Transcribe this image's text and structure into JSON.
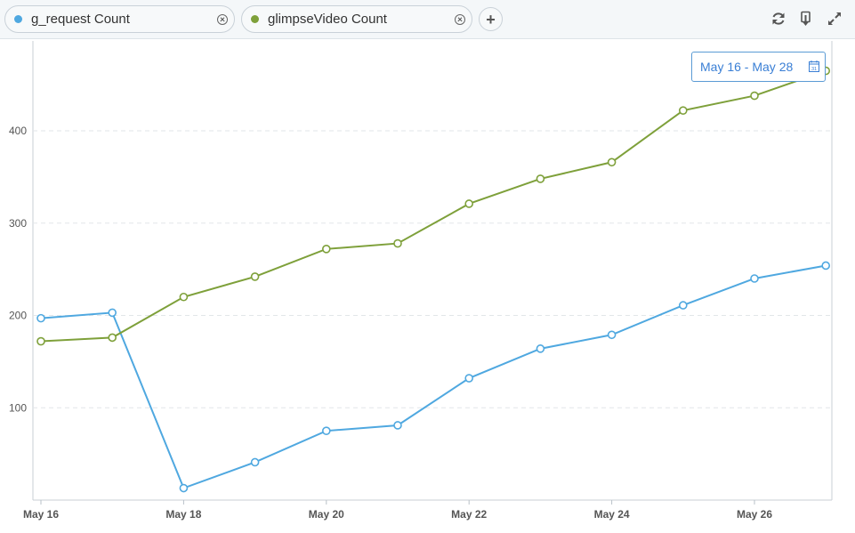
{
  "toolbar": {
    "pills": [
      {
        "label": "g_request Count",
        "color": "#4fa8e0"
      },
      {
        "label": "glimpseVideo Count",
        "color": "#7ea03a"
      }
    ],
    "add_label": "+",
    "icons": [
      "refresh-icon",
      "export-icon",
      "expand-icon"
    ]
  },
  "date_range": {
    "label": "May 16 - May 28",
    "icon": "calendar-icon"
  },
  "chart_data": {
    "type": "line",
    "x": [
      "May 16",
      "May 17",
      "May 18",
      "May 19",
      "May 20",
      "May 21",
      "May 22",
      "May 23",
      "May 24",
      "May 25",
      "May 26",
      "May 27"
    ],
    "x_tick_labels": [
      "May 16",
      "May 18",
      "May 20",
      "May 22",
      "May 24",
      "May 26"
    ],
    "series": [
      {
        "name": "g_request Count",
        "color": "#4fa8e0",
        "values": [
          197,
          203,
          13,
          41,
          75,
          81,
          132,
          164,
          179,
          211,
          240,
          254
        ]
      },
      {
        "name": "glimpseVideo Count",
        "color": "#7ea03a",
        "values": [
          172,
          176,
          220,
          242,
          272,
          278,
          321,
          348,
          366,
          422,
          438,
          465
        ]
      }
    ],
    "y_ticks": [
      100,
      200,
      300,
      400
    ],
    "ylim": [
      0,
      520
    ],
    "grid": true,
    "title": "",
    "xlabel": "",
    "ylabel": ""
  }
}
